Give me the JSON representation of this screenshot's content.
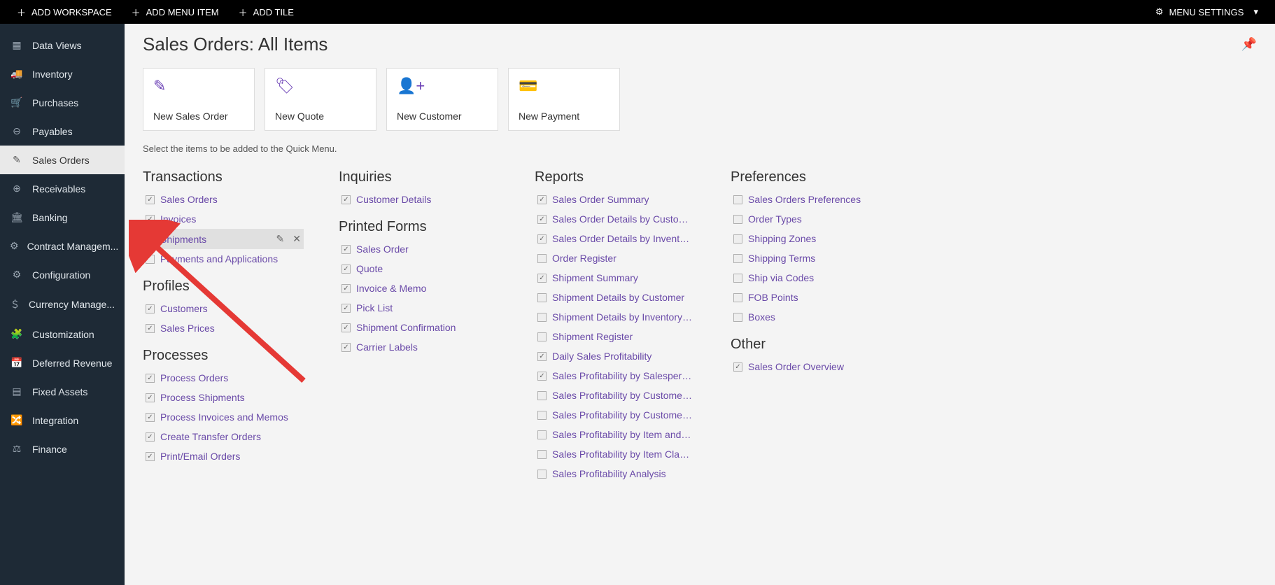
{
  "topbar": {
    "add_workspace": "ADD WORKSPACE",
    "add_menu_item": "ADD MENU ITEM",
    "add_tile": "ADD TILE",
    "menu_settings": "MENU SETTINGS"
  },
  "sidebar": {
    "items": [
      {
        "icon": "grid",
        "label": "Data Views"
      },
      {
        "icon": "truck",
        "label": "Inventory"
      },
      {
        "icon": "cart",
        "label": "Purchases"
      },
      {
        "icon": "minus-circle",
        "label": "Payables"
      },
      {
        "icon": "pencil",
        "label": "Sales Orders",
        "active": true
      },
      {
        "icon": "plus-circle",
        "label": "Receivables"
      },
      {
        "icon": "bank",
        "label": "Banking"
      },
      {
        "icon": "gears",
        "label": "Contract Managem..."
      },
      {
        "icon": "gear",
        "label": "Configuration"
      },
      {
        "icon": "dollar",
        "label": "Currency Manage..."
      },
      {
        "icon": "puzzle",
        "label": "Customization"
      },
      {
        "icon": "calendar",
        "label": "Deferred Revenue"
      },
      {
        "icon": "grid4",
        "label": "Fixed Assets"
      },
      {
        "icon": "share",
        "label": "Integration"
      },
      {
        "icon": "scale",
        "label": "Finance"
      }
    ]
  },
  "page": {
    "title": "Sales Orders: All Items",
    "hint": "Select the items to be added to the Quick Menu."
  },
  "tiles": [
    {
      "icon": "edit",
      "label": "New Sales Order"
    },
    {
      "icon": "tag",
      "label": "New Quote"
    },
    {
      "icon": "person-add",
      "label": "New Customer"
    },
    {
      "icon": "card",
      "label": "New Payment"
    }
  ],
  "columns": [
    {
      "sections": [
        {
          "title": "Transactions",
          "items": [
            {
              "label": "Sales Orders",
              "checked": true
            },
            {
              "label": "Invoices",
              "checked": true
            },
            {
              "label": "Shipments",
              "checked": true,
              "hover": true
            },
            {
              "label": "Payments and Applications",
              "checked": false
            }
          ]
        },
        {
          "title": "Profiles",
          "items": [
            {
              "label": "Customers",
              "checked": true
            },
            {
              "label": "Sales Prices",
              "checked": true
            }
          ]
        },
        {
          "title": "Processes",
          "items": [
            {
              "label": "Process Orders",
              "checked": true
            },
            {
              "label": "Process Shipments",
              "checked": true
            },
            {
              "label": "Process Invoices and Memos",
              "checked": true
            },
            {
              "label": "Create Transfer Orders",
              "checked": true
            },
            {
              "label": "Print/Email Orders",
              "checked": true
            }
          ]
        }
      ]
    },
    {
      "sections": [
        {
          "title": "Inquiries",
          "items": [
            {
              "label": "Customer Details",
              "checked": true
            }
          ]
        },
        {
          "title": "Printed Forms",
          "items": [
            {
              "label": "Sales Order",
              "checked": true
            },
            {
              "label": "Quote",
              "checked": true
            },
            {
              "label": "Invoice & Memo",
              "checked": true
            },
            {
              "label": "Pick List",
              "checked": true
            },
            {
              "label": "Shipment Confirmation",
              "checked": true
            },
            {
              "label": "Carrier Labels",
              "checked": true
            }
          ]
        }
      ]
    },
    {
      "sections": [
        {
          "title": "Reports",
          "items": [
            {
              "label": "Sales Order Summary",
              "checked": true
            },
            {
              "label": "Sales Order Details by Customer",
              "checked": true
            },
            {
              "label": "Sales Order Details by Inventory ...",
              "checked": true
            },
            {
              "label": "Order Register",
              "checked": false
            },
            {
              "label": "Shipment Summary",
              "checked": true
            },
            {
              "label": "Shipment Details by Customer",
              "checked": false
            },
            {
              "label": "Shipment Details by Inventory Item",
              "checked": false
            },
            {
              "label": "Shipment Register",
              "checked": false
            },
            {
              "label": "Daily Sales Profitability",
              "checked": true
            },
            {
              "label": "Sales Profitability by Salesperson...",
              "checked": true
            },
            {
              "label": "Sales Profitability by Customer Cl...",
              "checked": false
            },
            {
              "label": "Sales Profitability by Customer a...",
              "checked": false
            },
            {
              "label": "Sales Profitability by Item and Or...",
              "checked": false
            },
            {
              "label": "Sales Profitability by Item Class a...",
              "checked": false
            },
            {
              "label": "Sales Profitability Analysis",
              "checked": false
            }
          ]
        }
      ]
    },
    {
      "sections": [
        {
          "title": "Preferences",
          "items": [
            {
              "label": "Sales Orders Preferences",
              "checked": false
            },
            {
              "label": "Order Types",
              "checked": false
            },
            {
              "label": "Shipping Zones",
              "checked": false
            },
            {
              "label": "Shipping Terms",
              "checked": false
            },
            {
              "label": "Ship via Codes",
              "checked": false
            },
            {
              "label": "FOB Points",
              "checked": false
            },
            {
              "label": "Boxes",
              "checked": false
            }
          ]
        },
        {
          "title": "Other",
          "items": [
            {
              "label": "Sales Order Overview",
              "checked": true
            }
          ]
        }
      ]
    }
  ]
}
